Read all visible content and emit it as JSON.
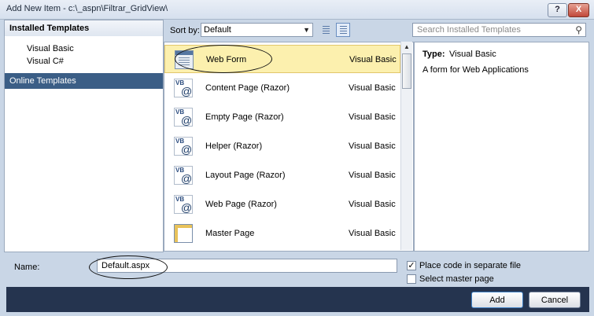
{
  "window": {
    "title": "Add New Item - c:\\_aspn\\Filtrar_GridView\\",
    "help_label": "?",
    "close_label": "X"
  },
  "left_pane": {
    "header": "Installed Templates",
    "items": [
      {
        "label": "Visual Basic"
      },
      {
        "label": "Visual C#"
      }
    ],
    "online": "Online Templates"
  },
  "toolbar": {
    "sort_label": "Sort by:",
    "sort_value": "Default",
    "search_placeholder": "Search Installed Templates"
  },
  "templates": [
    {
      "name": "Web Form",
      "type": "Visual Basic",
      "icon": "web-form-icon",
      "selected": true
    },
    {
      "name": "Content Page (Razor)",
      "type": "Visual Basic",
      "icon": "vb-razor-icon"
    },
    {
      "name": "Empty Page (Razor)",
      "type": "Visual Basic",
      "icon": "vb-razor-icon"
    },
    {
      "name": "Helper (Razor)",
      "type": "Visual Basic",
      "icon": "vb-razor-icon"
    },
    {
      "name": "Layout Page (Razor)",
      "type": "Visual Basic",
      "icon": "vb-razor-icon"
    },
    {
      "name": "Web Page (Razor)",
      "type": "Visual Basic",
      "icon": "vb-razor-icon"
    },
    {
      "name": "Master Page",
      "type": "Visual Basic",
      "icon": "master-page-icon"
    }
  ],
  "details": {
    "type_label": "Type:",
    "type_value": "Visual Basic",
    "description": "A form for Web Applications"
  },
  "bottom": {
    "name_label": "Name:",
    "name_value": "Default.aspx",
    "separate_label": "Place code in separate file",
    "separate_checked": true,
    "master_label": "Select master page",
    "master_checked": false
  },
  "buttons": {
    "add": "Add",
    "cancel": "Cancel"
  },
  "colors": {
    "selected_row": "#fcf0ae",
    "footer": "#25344f",
    "online_selected": "#3b5e86"
  }
}
